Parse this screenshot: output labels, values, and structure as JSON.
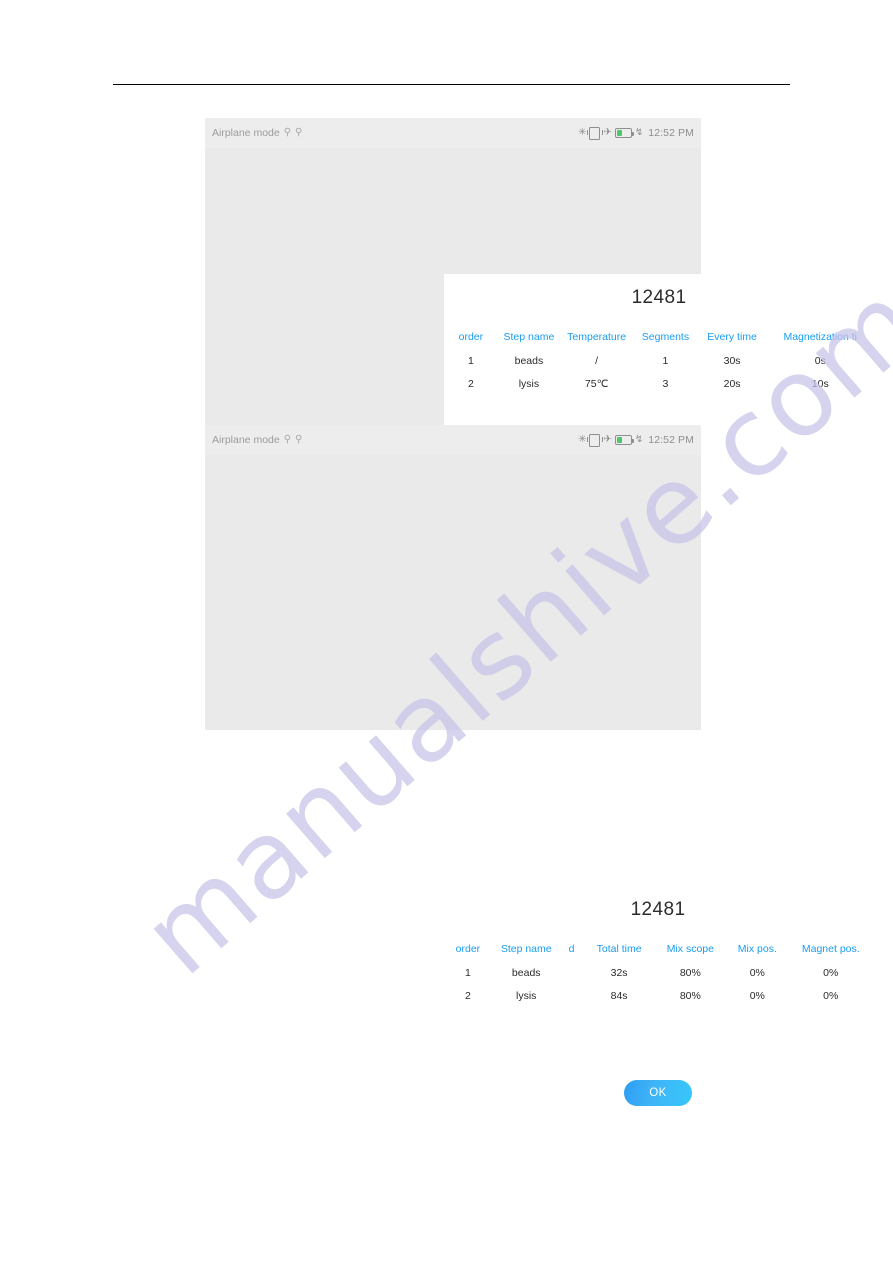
{
  "document": {
    "background_color": "#ffffff",
    "rule_color": "#000000"
  },
  "watermark": {
    "text": "manualshive.com",
    "color": "#c7c3e8"
  },
  "theme": {
    "accent_blue": "#1a9cf0",
    "button_gradient_start": "#2f9df4",
    "button_gradient_end": "#36c6fb",
    "frame_gray": "#eaeaea",
    "status_bar_gray": "#ededed",
    "battery_green": "#4cc76a"
  },
  "status_bar": {
    "airplane_label": "Airplane mode",
    "usb_icon_1": "usb-icon",
    "usb_icon_2": "usb-icon",
    "bluetooth_icon": "✳",
    "vibrate_icon": "vibrate-icon",
    "airplane_icon": "✈",
    "battery_icon": "battery-icon",
    "charge_icon": "↯",
    "time": "12:52 PM"
  },
  "screens": [
    {
      "id": "screen-parameters",
      "title": "12481",
      "table": {
        "headers": [
          "order",
          "Step name",
          "Temperature",
          "Segments",
          "Every time",
          "Magnetization ti"
        ],
        "rows": [
          [
            "1",
            "beads",
            "/",
            "1",
            "30s",
            "0s"
          ],
          [
            "2",
            "lysis",
            "75℃",
            "3",
            "20s",
            "10s"
          ]
        ]
      },
      "ok_label": "OK"
    },
    {
      "id": "screen-timing",
      "title": "12481",
      "table": {
        "headers": [
          "order",
          "Step name",
          "d",
          "Total time",
          "Mix scope",
          "Mix pos.",
          "Magnet pos."
        ],
        "rows": [
          [
            "1",
            "beads",
            "",
            "32s",
            "80%",
            "0%",
            "0%"
          ],
          [
            "2",
            "lysis",
            "",
            "84s",
            "80%",
            "0%",
            "0%"
          ]
        ]
      },
      "ok_label": "OK"
    }
  ]
}
